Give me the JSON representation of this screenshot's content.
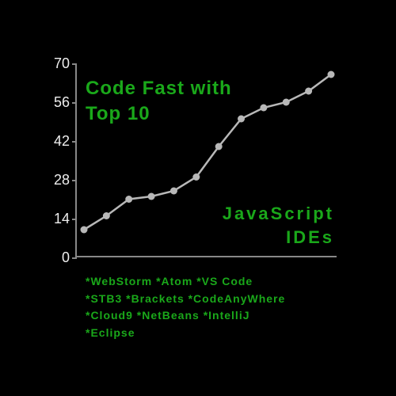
{
  "chart_data": {
    "type": "line",
    "title_top": "Code Fast with\nTop 10",
    "title_bottom": "JavaScript\nIDEs",
    "yticks": [
      0,
      14,
      28,
      42,
      56,
      70
    ],
    "ylim": [
      0,
      70
    ],
    "x": [
      1,
      2,
      3,
      4,
      5,
      6,
      7,
      8,
      9,
      10,
      11,
      12
    ],
    "values": [
      10,
      15,
      21,
      22,
      24,
      29,
      40,
      50,
      54,
      56,
      60,
      66
    ],
    "line_color": "#b8b8b8",
    "marker_color": "#b8b8b8"
  },
  "footer": {
    "lines": [
      "*WebStorm *Atom *VS Code",
      "*STB3 *Brackets *CodeAnyWhere",
      "*Cloud9 *NetBeans *IntelliJ",
      "*Eclipse"
    ]
  }
}
